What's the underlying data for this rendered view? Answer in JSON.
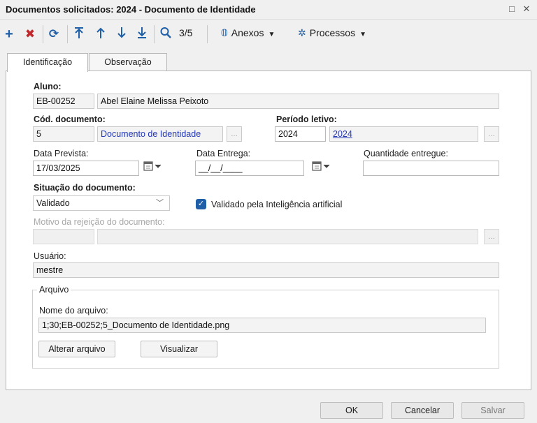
{
  "window": {
    "title": "Documentos solicitados: 2024 - Documento de Identidade",
    "minimize_glyph": "□",
    "close_glyph": "✕"
  },
  "toolbar": {
    "add_icon": "plus-icon",
    "delete_icon": "x-icon",
    "refresh_icon": "refresh-icon",
    "record_position": "3/5",
    "anexos_label": "Anexos",
    "processos_label": "Processos"
  },
  "tabs": [
    {
      "label": "Identificação",
      "active": true
    },
    {
      "label": "Observação",
      "active": false
    }
  ],
  "form": {
    "aluno": {
      "label": "Aluno:",
      "code": "EB-00252",
      "name": "Abel Elaine Melissa Peixoto"
    },
    "cod_documento": {
      "label": "Cód. documento:",
      "code": "5",
      "name": "Documento de Identidade"
    },
    "periodo_letivo": {
      "label": "Período letivo:",
      "code": "2024",
      "name": "2024"
    },
    "data_prevista": {
      "label": "Data Prevista:",
      "value": "17/03/2025"
    },
    "data_entrega": {
      "label": "Data Entrega:",
      "value": "__/__/____"
    },
    "quantidade_entregue": {
      "label": "Quantidade entregue:",
      "value": ""
    },
    "situacao": {
      "label": "Situação do documento:",
      "value": "Validado"
    },
    "validado_ia": {
      "label": "Validado pela Inteligência artificial",
      "checked": true
    },
    "motivo_rejeicao": {
      "label": "Motivo da rejeição do documento:",
      "code": "",
      "name": ""
    },
    "usuario": {
      "label": "Usuário:",
      "value": "mestre"
    }
  },
  "arquivo": {
    "legend": "Arquivo",
    "nome_label": "Nome do arquivo:",
    "nome_value": "1;30;EB-00252;5_Documento de Identidade.png",
    "alterar_label": "Alterar arquivo",
    "visualizar_label": "Visualizar"
  },
  "footer": {
    "ok_label": "OK",
    "cancel_label": "Cancelar",
    "save_label": "Salvar"
  },
  "colors": {
    "accent_blue": "#1f5fa8",
    "delete_red": "#c0282b",
    "link_blue": "#2438b8"
  }
}
